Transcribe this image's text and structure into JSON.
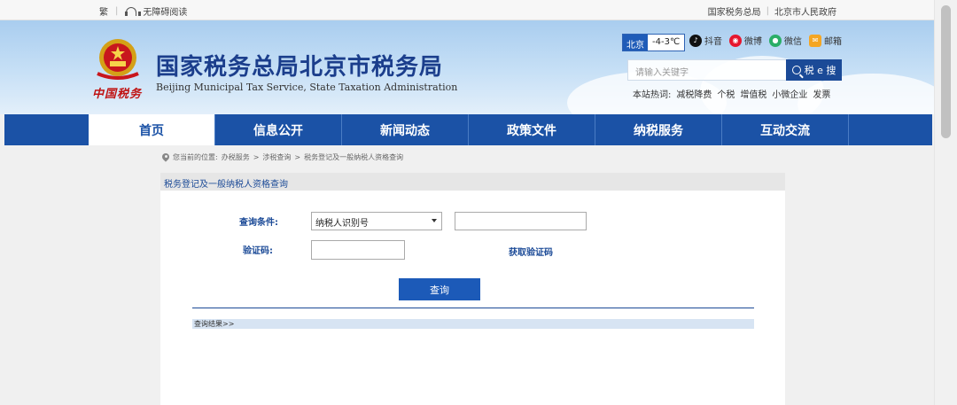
{
  "topbar": {
    "traditional": "繁",
    "accessibility": "无障碍阅读",
    "links": [
      "国家税务总局",
      "北京市人民政府"
    ]
  },
  "header": {
    "logo_text": "中国税务",
    "title": "国家税务总局北京市税务局",
    "subtitle": "Beijing Municipal Tax Service, State Taxation Administration",
    "weather": {
      "city": "北京",
      "temp": "-4-3℃"
    },
    "social": [
      {
        "label": "抖音",
        "icon": "douyin-icon",
        "color": "#111111"
      },
      {
        "label": "微博",
        "icon": "weibo-icon",
        "color": "#e6162d"
      },
      {
        "label": "微信",
        "icon": "wechat-icon",
        "color": "#2aae67"
      },
      {
        "label": "邮箱",
        "icon": "mail-icon",
        "color": "#f5a623"
      }
    ],
    "search": {
      "placeholder": "请输入关键字",
      "button": "税 e 搜"
    },
    "hotwords_label": "本站热词:",
    "hotwords": [
      "减税降费",
      "个税",
      "增值税",
      "小微企业",
      "发票"
    ]
  },
  "nav": {
    "items": [
      "首页",
      "信息公开",
      "新闻动态",
      "政策文件",
      "纳税服务",
      "互动交流"
    ],
    "active_index": 0
  },
  "breadcrumb": {
    "prefix": "您当前的位置:",
    "items": [
      "办税服务",
      "涉税查询",
      "税务登记及一般纳税人资格查询"
    ],
    "separator": ">"
  },
  "form": {
    "panel_title": "税务登记及一般纳税人资格查询",
    "condition_label": "查询条件:",
    "condition_value": "纳税人识别号",
    "captcha_label": "验证码:",
    "get_captcha": "获取验证码",
    "query_button": "查询",
    "result_label": "查询结果>>"
  },
  "colors": {
    "brand_blue": "#1b52a6",
    "accent_red": "#c01313"
  }
}
